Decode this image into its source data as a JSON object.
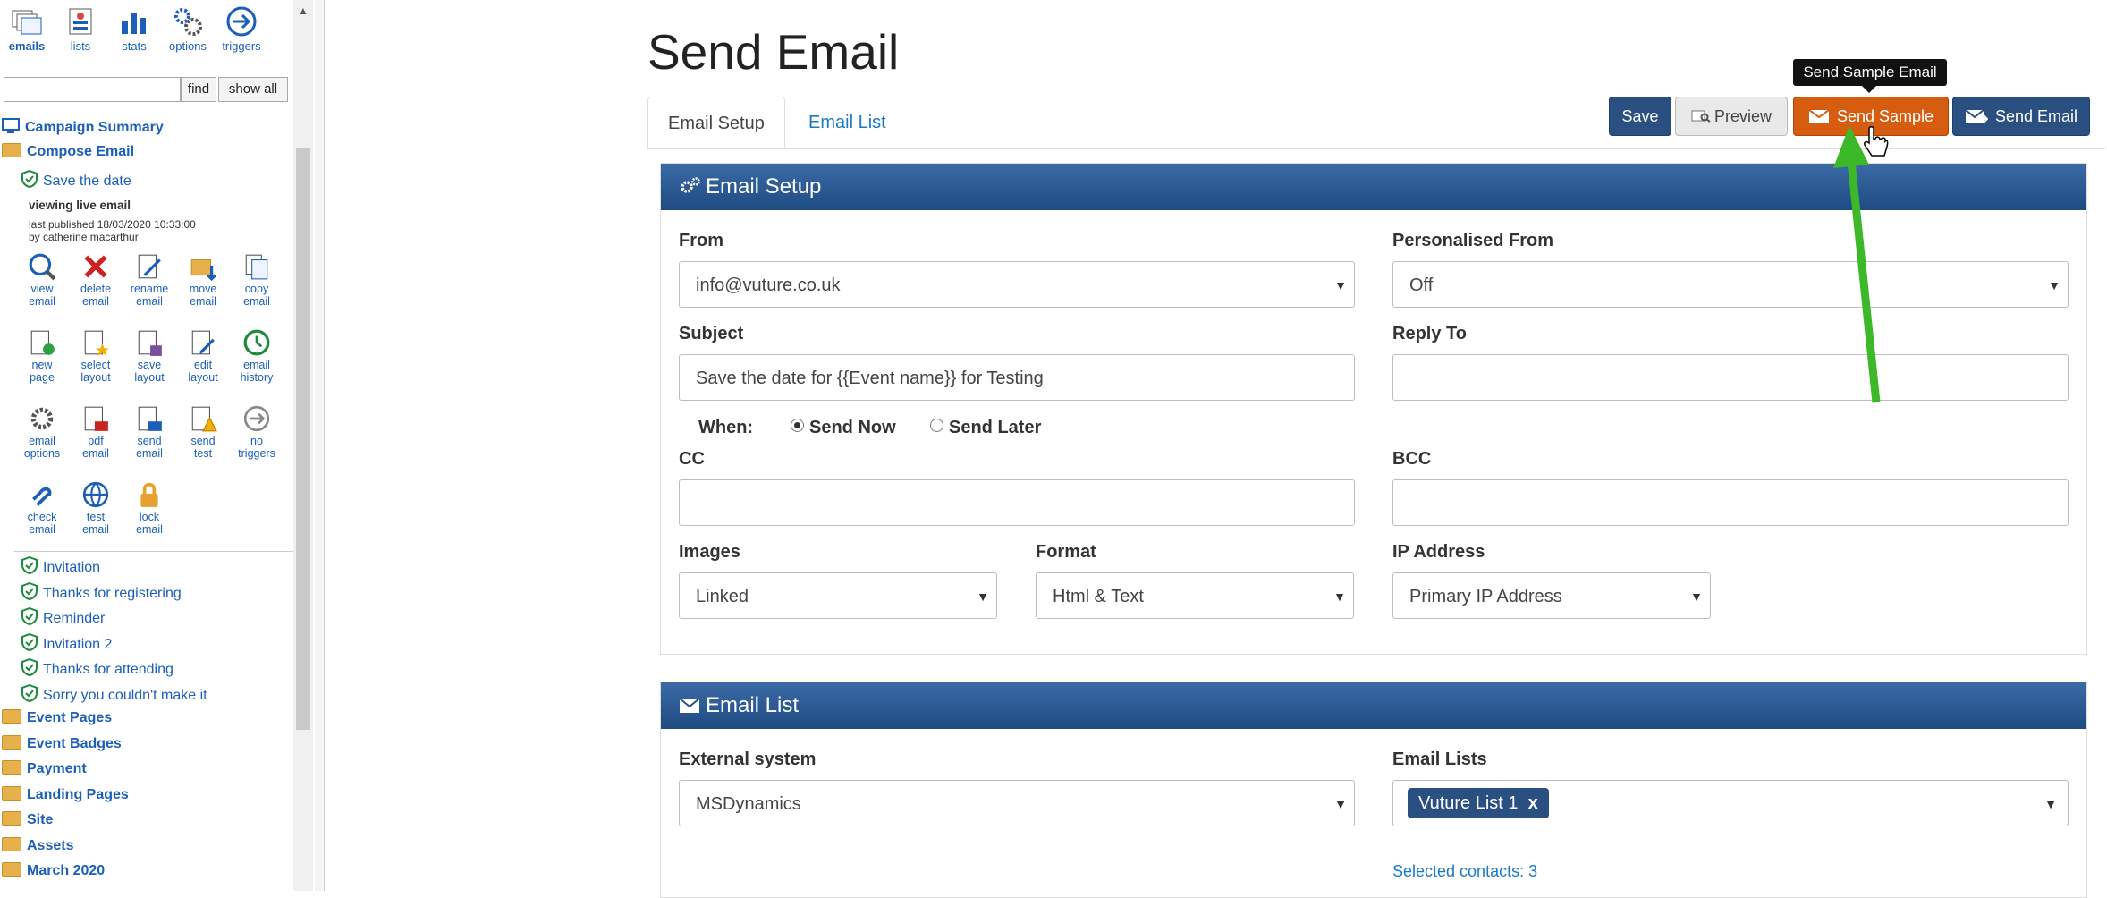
{
  "sidebar": {
    "toolbar": [
      {
        "label": "emails",
        "icon": "emails-icon"
      },
      {
        "label": "lists",
        "icon": "lists-icon"
      },
      {
        "label": "stats",
        "icon": "stats-icon"
      },
      {
        "label": "options",
        "icon": "options-icon"
      },
      {
        "label": "triggers",
        "icon": "triggers-icon"
      }
    ],
    "search": {
      "value": "",
      "find_label": "find",
      "show_all_label": "show all"
    },
    "campaign_summary": "Campaign Summary",
    "compose_email": "Compose Email",
    "current_email": "Save the date",
    "meta": {
      "line1": "viewing  live  email",
      "line2": "last published 18/03/2020 10:33:00",
      "line3": "by catherine macarthur"
    },
    "actions": [
      {
        "l1": "view",
        "l2": "email"
      },
      {
        "l1": "delete",
        "l2": "email"
      },
      {
        "l1": "rename",
        "l2": "email"
      },
      {
        "l1": "move",
        "l2": "email"
      },
      {
        "l1": "copy",
        "l2": "email"
      },
      {
        "l1": "new",
        "l2": "page"
      },
      {
        "l1": "select",
        "l2": "layout"
      },
      {
        "l1": "save",
        "l2": "layout"
      },
      {
        "l1": "edit",
        "l2": "layout"
      },
      {
        "l1": "email",
        "l2": "history"
      },
      {
        "l1": "email",
        "l2": "options"
      },
      {
        "l1": "pdf",
        "l2": "email"
      },
      {
        "l1": "send",
        "l2": "email"
      },
      {
        "l1": "send",
        "l2": "test"
      },
      {
        "l1": "no",
        "l2": "triggers"
      },
      {
        "l1": "check",
        "l2": "email"
      },
      {
        "l1": "test",
        "l2": "email"
      },
      {
        "l1": "lock",
        "l2": "email"
      }
    ],
    "emails": [
      "Invitation",
      "Thanks for registering",
      "Reminder",
      "Invitation 2",
      "Thanks for attending",
      "Sorry you couldn't make it"
    ],
    "folders": [
      "Event Pages",
      "Event Badges",
      "Payment",
      "Landing Pages",
      "Site",
      "Assets",
      "March 2020"
    ]
  },
  "main": {
    "title": "Send Email",
    "tabs": [
      {
        "label": "Email Setup"
      },
      {
        "label": "Email List"
      }
    ],
    "buttons": {
      "save": "Save",
      "preview": "Preview",
      "send_sample": "Send Sample",
      "send_email": "Send Email"
    },
    "tooltip": "Send Sample Email",
    "setup": {
      "heading": "Email Setup",
      "from_label": "From",
      "from_value": "info@vuture.co.uk",
      "personalised_label": "Personalised From",
      "personalised_value": "Off",
      "subject_label": "Subject",
      "subject_value": "Save the date for {{Event name}} for Testing",
      "reply_label": "Reply To",
      "reply_value": "",
      "when_label": "When:",
      "send_now": "Send Now",
      "send_later": "Send Later",
      "cc_label": "CC",
      "cc_value": "",
      "bcc_label": "BCC",
      "bcc_value": "",
      "images_label": "Images",
      "images_value": "Linked",
      "format_label": "Format",
      "format_value": "Html & Text",
      "ip_label": "IP Address",
      "ip_value": "Primary IP Address"
    },
    "list": {
      "heading": "Email List",
      "external_label": "External system",
      "external_value": "MSDynamics",
      "lists_label": "Email Lists",
      "selected_list": "Vuture List 1",
      "remove": "x",
      "contacts": "Selected contacts: 3"
    }
  },
  "colors": {
    "accent": "#2a5082",
    "orange": "#d65d10",
    "link": "#1b5fb8",
    "annotation": "#3cb828"
  }
}
